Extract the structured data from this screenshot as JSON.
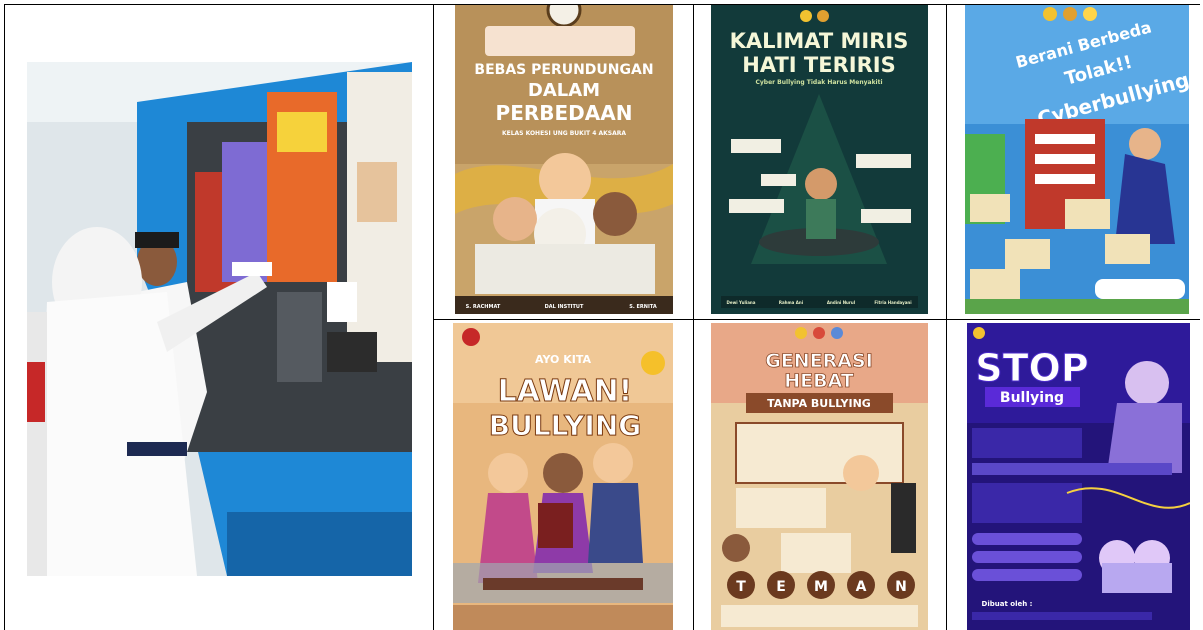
{
  "figure": {
    "photo": {
      "description_icon": "photo-icon"
    },
    "posters": [
      {
        "id": "p1",
        "title_lines": [
          "BEBAS PERUNDUNGAN",
          "DALAM",
          "PERBEDAAN"
        ],
        "subtitle": "KELAS KOHESI UNG BUKIT 4 AKSARA",
        "footer": [
          "S. RACHMAT",
          "DAL INSTITUT",
          "S. ERNITA"
        ]
      },
      {
        "id": "p2",
        "title_lines": [
          "KALIMAT MIRIS",
          "HATI TERIRIS"
        ],
        "subtitle": "Cyber Bullying Tidak Harus Menyakiti",
        "footer": [
          "Dewi Yuliana",
          "Rahma Ani",
          "Andini Nurul",
          "Fitria Handayani"
        ]
      },
      {
        "id": "p3",
        "title_lines": [
          "Berani Berbeda",
          "Tolak!!",
          "Cyberbullying"
        ],
        "subtitle": "",
        "footer": []
      },
      {
        "id": "p4",
        "title_lines": [
          "AYO KITA",
          "LAWAN!",
          "BULLYING"
        ],
        "subtitle": "",
        "footer": []
      },
      {
        "id": "p5",
        "title_lines": [
          "GENERASI",
          "HEBAT",
          "TANPA BULLYING"
        ],
        "subtitle": "",
        "footer": [
          "T",
          "E",
          "M",
          "A",
          "N"
        ]
      },
      {
        "id": "p6",
        "title_lines": [
          "STOP",
          "Bullying"
        ],
        "subtitle": "Dibuat oleh :",
        "footer": []
      }
    ]
  },
  "colors": {
    "border": "#000000",
    "wall_blue": "#1e88d6",
    "p1_bg": "#c9a46a",
    "p2_bg": "#123a3a",
    "p3_bg": "#3b8fd6",
    "p4_bg": "#e8b77e",
    "p5_bg": "#e9cda0",
    "p6_bg": "#23147a"
  }
}
